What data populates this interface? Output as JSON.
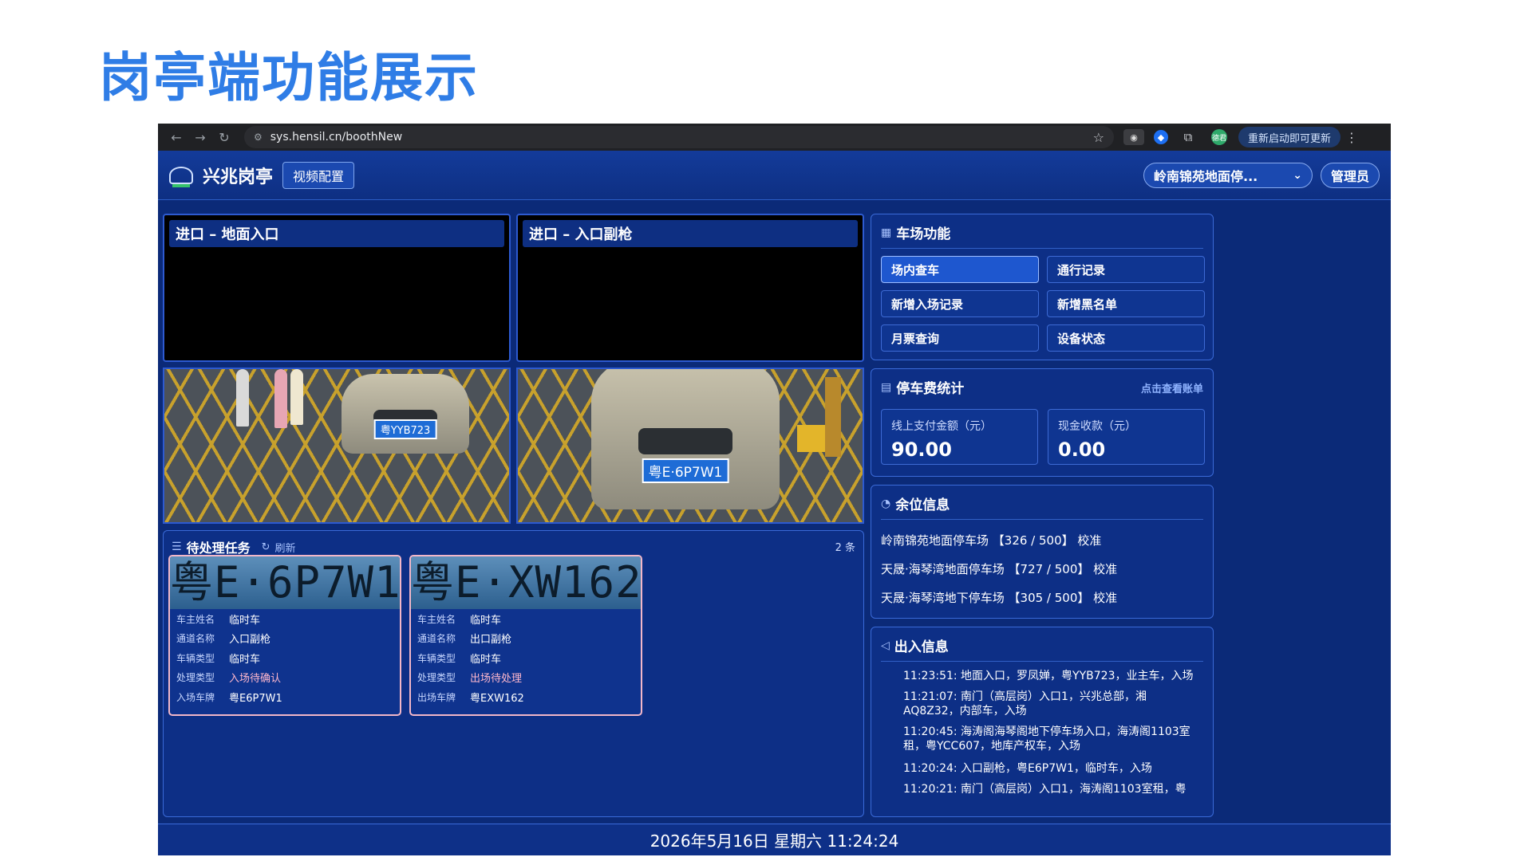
{
  "slide": {
    "title": "岗亭端功能展示"
  },
  "browser": {
    "url": "sys.hensil.cn/boothNew",
    "profile_label": "德君",
    "update_label": "重新启动即可更新"
  },
  "header": {
    "app_name": "兴兆岗亭",
    "video_config": "视频配置",
    "lot_selected": "岭南锦苑地面停...",
    "admin": "管理员"
  },
  "cameras": [
    {
      "title": "进口 – 地面入口",
      "plate": "粤YYB723"
    },
    {
      "title": "进口 – 入口副枪",
      "plate": "粤E·6P7W1"
    }
  ],
  "functions": {
    "title": "车场功能",
    "buttons": [
      "场内查车",
      "通行记录",
      "新增入场记录",
      "新增黑名单",
      "月票查询",
      "设备状态"
    ],
    "active": "场内查车"
  },
  "fees": {
    "title": "停车费统计",
    "link": "点击查看账单",
    "online_label": "线上支付金额（元）",
    "online_value": "90.00",
    "cash_label": "现金收款（元）",
    "cash_value": "0.00"
  },
  "slots": {
    "title": "余位信息",
    "items": [
      "岭南锦苑地面停车场 【326 / 500】 校准",
      "天晟·海琴湾地面停车场 【727 / 500】 校准",
      "天晟·海琴湾地下停车场 【305 / 500】 校准"
    ]
  },
  "io": {
    "title": "出入信息",
    "items": [
      "11:23:51: 地面入口，罗凤婵，粤YYB723，业主车，入场",
      "11:21:07: 南门（高层岗）入口1，兴兆总部，湘AQ8Z32，内部车，入场",
      "11:20:45: 海涛阁海琴阁地下停车场入口，海涛阁1103室租，粤YCC607，地库产权车，入场",
      "11:20:24: 入口副枪，粤E6P7W1，临时车，入场",
      "11:20:21: 南门（高层岗）入口1，海涛阁1103室租，粤"
    ]
  },
  "tasks": {
    "title": "待处理任务",
    "refresh": "刷新",
    "count": "2 条",
    "cards": [
      {
        "plate_img": "粤E·6P7W1",
        "owner_k": "车主姓名",
        "owner": "临时车",
        "channel_k": "通道名称",
        "channel": "入口副枪",
        "type_k": "车辆类型",
        "type": "临时车",
        "proc_k": "处理类型",
        "proc": "入场待确认",
        "plate_k": "入场车牌",
        "plate": "粤E6P7W1"
      },
      {
        "plate_img": "粤E·XW162",
        "owner_k": "车主姓名",
        "owner": "临时车",
        "channel_k": "通道名称",
        "channel": "出口副枪",
        "type_k": "车辆类型",
        "type": "临时车",
        "proc_k": "处理类型",
        "proc": "出场待处理",
        "plate_k": "出场车牌",
        "plate": "粤EXW162"
      }
    ]
  },
  "status_bar": {
    "datetime": "2026年5月16日 星期六 11:24:24"
  },
  "colors": {
    "accent": "#2f7de6",
    "panel": "#0d2f86",
    "pink": "#ffb8cd"
  }
}
